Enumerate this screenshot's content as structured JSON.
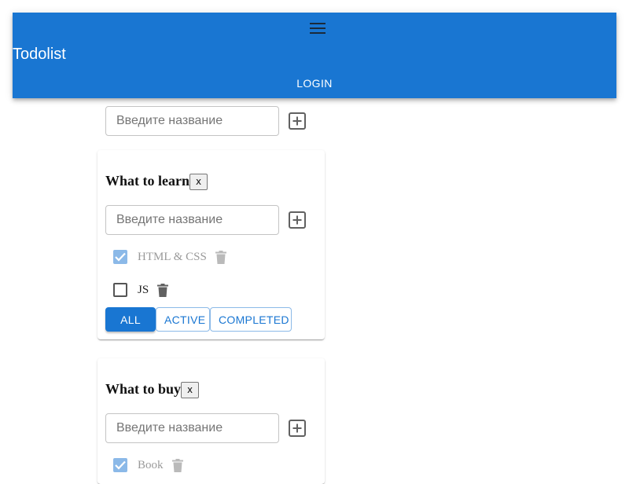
{
  "app": {
    "title": "Todolist",
    "login_label": "LOGIN",
    "accent_color": "#1976d2"
  },
  "new_list_form": {
    "placeholder": "Введите название"
  },
  "todolists": [
    {
      "title": "What to learn",
      "delete_label": "x",
      "input_placeholder": "Введите название",
      "tasks": [
        {
          "title": "HTML & CSS",
          "done": true
        },
        {
          "title": "JS",
          "done": false
        }
      ],
      "filters": {
        "all": "ALL",
        "active": "ACTIVE",
        "completed": "COMPLETED",
        "selected": "all"
      }
    },
    {
      "title": "What to buy",
      "delete_label": "x",
      "input_placeholder": "Введите название",
      "tasks": [
        {
          "title": "Book",
          "done": true
        }
      ]
    }
  ]
}
